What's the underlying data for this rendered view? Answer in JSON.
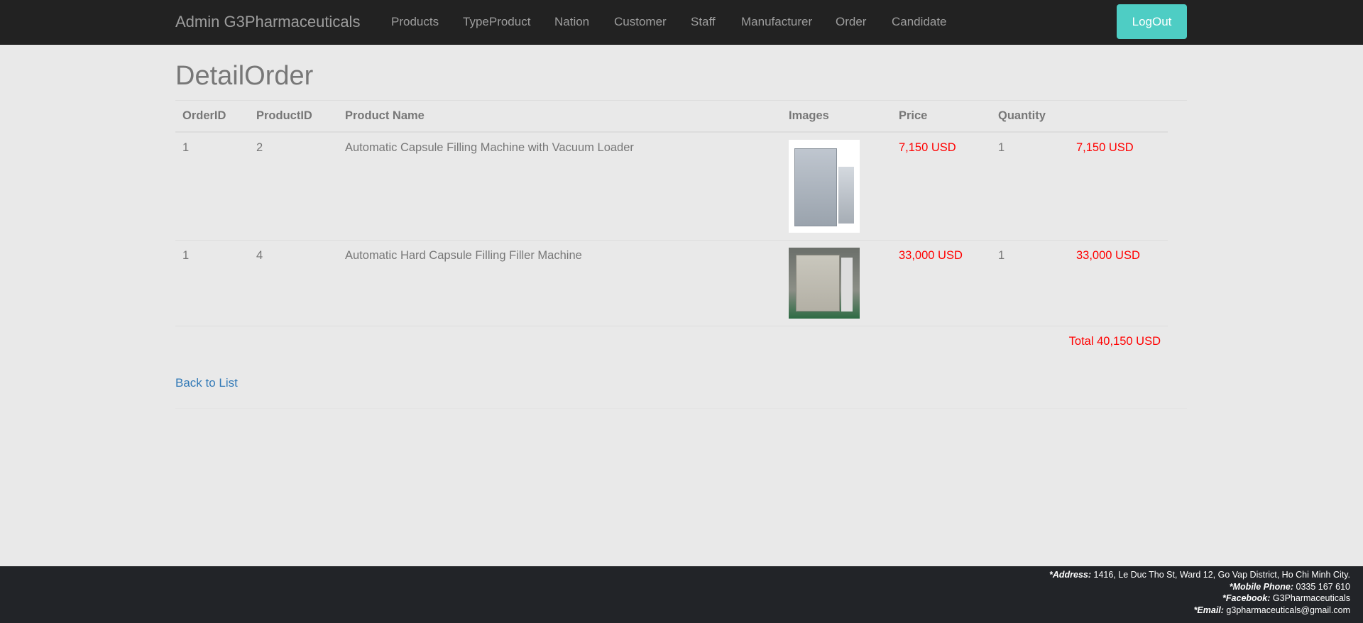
{
  "nav": {
    "brand": "Admin G3Pharmaceuticals",
    "items": [
      "Products",
      "TypeProduct",
      "Nation",
      "Customer",
      "Staff",
      "Manufacturer",
      "Order",
      "Candidate"
    ],
    "logout": "LogOut"
  },
  "page": {
    "title": "DetailOrder",
    "back": "Back to List",
    "total": "Total 40,150 USD"
  },
  "table": {
    "headers": [
      "OrderID",
      "ProductID",
      "Product Name",
      "Images",
      "Price",
      "Quantity"
    ],
    "rows": [
      {
        "order_id": "1",
        "product_id": "2",
        "name": "Automatic Capsule Filling Machine with Vacuum Loader",
        "price": "7,150 USD",
        "quantity": "1",
        "subtotal": "7,150 USD"
      },
      {
        "order_id": "1",
        "product_id": "4",
        "name": "Automatic Hard Capsule Filling Filler Machine",
        "price": "33,000 USD",
        "quantity": "1",
        "subtotal": "33,000 USD"
      }
    ]
  },
  "footer": {
    "address_label": "*Address:",
    "address": " 1416, Le Duc Tho St, Ward 12, Go Vap District, Ho Chi Minh City.",
    "phone_label": "*Mobile Phone:",
    "phone": " 0335 167 610",
    "facebook_label": "*Facebook:",
    "facebook": " G3Pharmaceuticals",
    "email_label": "*Email:",
    "email": " g3pharmaceuticals@gmail.com"
  },
  "colors": {
    "accent": "#4ecdc4",
    "price": "#ff0000",
    "link": "#337ab7"
  }
}
